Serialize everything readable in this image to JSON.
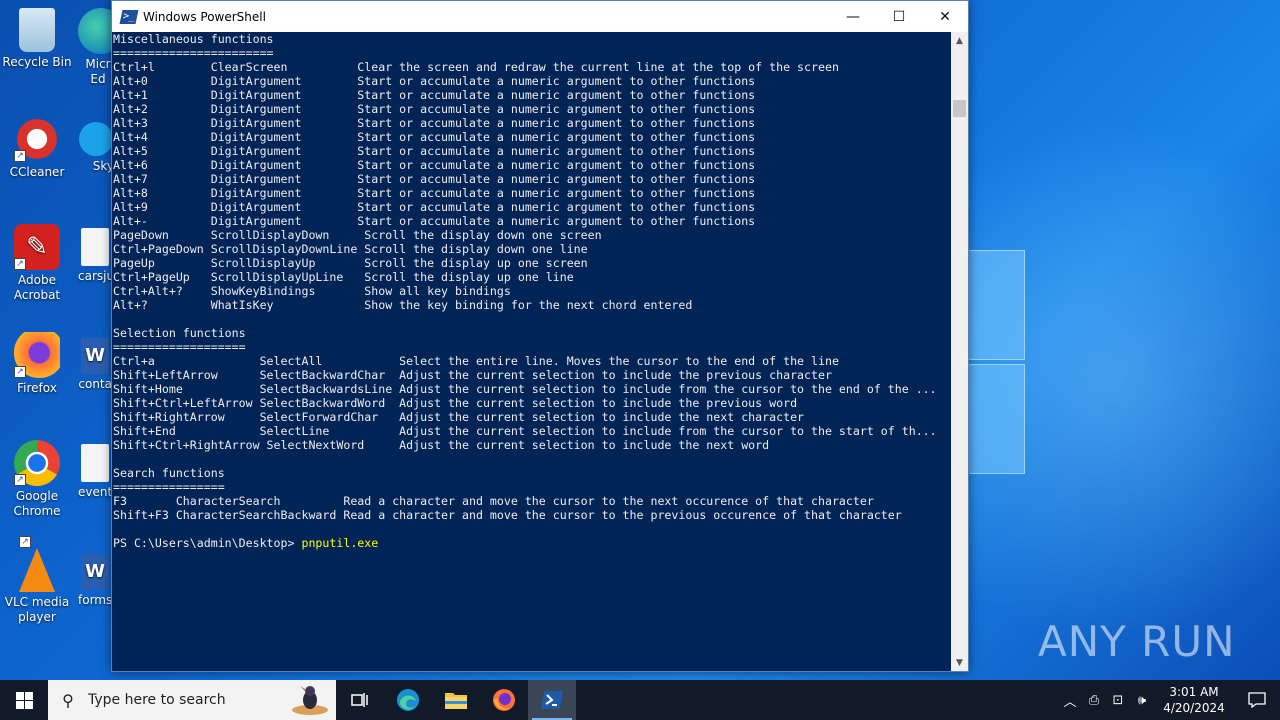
{
  "desktop": {
    "icons": [
      {
        "label": "Recycle Bin"
      },
      {
        "label": "Micr Ed"
      },
      {
        "label": "CCleaner"
      },
      {
        "label": "Sky"
      },
      {
        "label": "Adobe Acrobat"
      },
      {
        "label": "carsju"
      },
      {
        "label": "Firefox"
      },
      {
        "label": "conta"
      },
      {
        "label": "Google Chrome"
      },
      {
        "label": "events"
      },
      {
        "label": "VLC media player"
      },
      {
        "label": "forms"
      }
    ],
    "watermark": "ANY RUN"
  },
  "window": {
    "title": "Windows PowerShell",
    "controls": {
      "minimize": "—",
      "maximize": "☐",
      "close": "✕"
    }
  },
  "console": {
    "lines": [
      "Miscellaneous functions",
      "=======================",
      "Ctrl+l        ClearScreen          Clear the screen and redraw the current line at the top of the screen",
      "Alt+0         DigitArgument        Start or accumulate a numeric argument to other functions",
      "Alt+1         DigitArgument        Start or accumulate a numeric argument to other functions",
      "Alt+2         DigitArgument        Start or accumulate a numeric argument to other functions",
      "Alt+3         DigitArgument        Start or accumulate a numeric argument to other functions",
      "Alt+4         DigitArgument        Start or accumulate a numeric argument to other functions",
      "Alt+5         DigitArgument        Start or accumulate a numeric argument to other functions",
      "Alt+6         DigitArgument        Start or accumulate a numeric argument to other functions",
      "Alt+7         DigitArgument        Start or accumulate a numeric argument to other functions",
      "Alt+8         DigitArgument        Start or accumulate a numeric argument to other functions",
      "Alt+9         DigitArgument        Start or accumulate a numeric argument to other functions",
      "Alt+-         DigitArgument        Start or accumulate a numeric argument to other functions",
      "PageDown      ScrollDisplayDown     Scroll the display down one screen",
      "Ctrl+PageDown ScrollDisplayDownLine Scroll the display down one line",
      "PageUp        ScrollDisplayUp       Scroll the display up one screen",
      "Ctrl+PageUp   ScrollDisplayUpLine   Scroll the display up one line",
      "Ctrl+Alt+?    ShowKeyBindings       Show all key bindings",
      "Alt+?         WhatIsKey             Show the key binding for the next chord entered",
      "",
      "Selection functions",
      "===================",
      "Ctrl+a               SelectAll           Select the entire line. Moves the cursor to the end of the line",
      "Shift+LeftArrow      SelectBackwardChar  Adjust the current selection to include the previous character",
      "Shift+Home           SelectBackwardsLine Adjust the current selection to include from the cursor to the end of the ...",
      "Shift+Ctrl+LeftArrow SelectBackwardWord  Adjust the current selection to include the previous word",
      "Shift+RightArrow     SelectForwardChar   Adjust the current selection to include the next character",
      "Shift+End            SelectLine          Adjust the current selection to include from the cursor to the start of th...",
      "Shift+Ctrl+RightArrow SelectNextWord     Adjust the current selection to include the next word",
      "",
      "Search functions",
      "================",
      "F3       CharacterSearch         Read a character and move the cursor to the next occurence of that character",
      "Shift+F3 CharacterSearchBackward Read a character and move the cursor to the previous occurence of that character",
      ""
    ],
    "prompt": "PS C:\\Users\\admin\\Desktop> ",
    "command": "pnputil.exe"
  },
  "taskbar": {
    "search_placeholder": "Type here to search",
    "clock_time": "3:01 AM",
    "clock_date": "4/20/2024"
  }
}
